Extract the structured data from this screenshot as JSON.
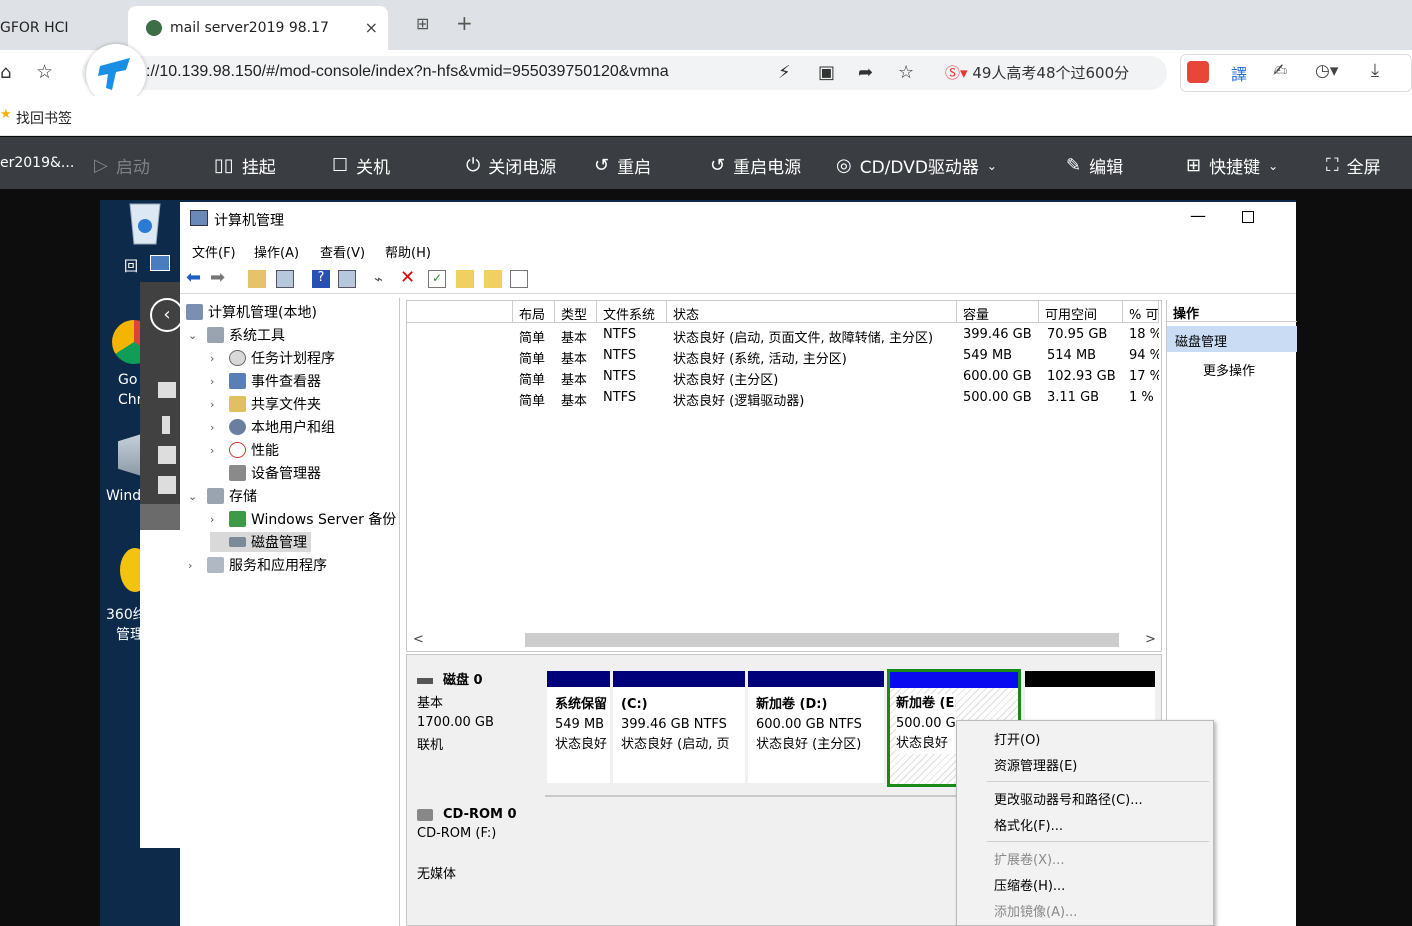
{
  "browser": {
    "tabs": [
      {
        "label": "GFOR HCI"
      },
      {
        "label": "mail server2019 98.17",
        "close": "×"
      }
    ],
    "new_tab": "+",
    "url": "://10.139.98.150/#/mod-console/index?n-hfs&vmid=955039750120&vmna",
    "hot_search": "49人高考48个过600分",
    "bookmark": "找回书签"
  },
  "console_toolbar": {
    "vm_name": "er2019&...",
    "buttons": [
      {
        "label": "启动",
        "icon": "play-icon",
        "disabled": true
      },
      {
        "label": "挂起",
        "icon": "pause-icon",
        "disabled": false
      },
      {
        "label": "关机",
        "icon": "stop-icon",
        "disabled": false
      },
      {
        "label": "关闭电源",
        "icon": "power-icon",
        "disabled": false
      },
      {
        "label": "重启",
        "icon": "restart-icon",
        "disabled": false
      },
      {
        "label": "重启电源",
        "icon": "power-restart-icon",
        "disabled": false
      },
      {
        "label": "CD/DVD驱动器",
        "icon": "disc-icon",
        "disabled": false
      },
      {
        "label": "编辑",
        "icon": "edit-icon",
        "disabled": false
      },
      {
        "label": "快捷键",
        "icon": "shortcut-icon",
        "disabled": false
      },
      {
        "label": "全屏",
        "icon": "fullscreen-icon",
        "disabled": false
      }
    ]
  },
  "desktop": {
    "icons": [
      {
        "label": "回"
      },
      {
        "label": "Go"
      },
      {
        "label": "Chr"
      },
      {
        "label": "Wind"
      },
      {
        "label": "360终"
      },
      {
        "label": "管理"
      }
    ]
  },
  "window": {
    "title": "计算机管理",
    "menus": [
      "文件(F)",
      "操作(A)",
      "查看(V)",
      "帮助(H)"
    ],
    "tree": [
      {
        "label": "计算机管理(本地)"
      },
      {
        "label": "系统工具"
      },
      {
        "label": "任务计划程序"
      },
      {
        "label": "事件查看器"
      },
      {
        "label": "共享文件夹"
      },
      {
        "label": "本地用户和组"
      },
      {
        "label": "性能"
      },
      {
        "label": "设备管理器"
      },
      {
        "label": "存储"
      },
      {
        "label": "Windows Server 备份"
      },
      {
        "label": "磁盘管理"
      },
      {
        "label": "服务和应用程序"
      }
    ],
    "columns": [
      "布局",
      "类型",
      "文件系统",
      "状态",
      "容量",
      "可用空间",
      "% 可"
    ],
    "rows": [
      [
        "简单",
        "基本",
        "NTFS",
        "状态良好 (启动, 页面文件, 故障转储, 主分区)",
        "399.46 GB",
        "70.95 GB",
        "18 %"
      ],
      [
        "简单",
        "基本",
        "NTFS",
        "状态良好 (系统, 活动, 主分区)",
        "549 MB",
        "514 MB",
        "94 %"
      ],
      [
        "简单",
        "基本",
        "NTFS",
        "状态良好 (主分区)",
        "600.00 GB",
        "102.93 GB",
        "17 %"
      ],
      [
        "简单",
        "基本",
        "NTFS",
        "状态良好 (逻辑驱动器)",
        "500.00 GB",
        "3.11 GB",
        "1 %"
      ]
    ],
    "scroll_left": "<",
    "scroll_right": ">",
    "disk0": {
      "name": "磁盘 0",
      "type": "基本",
      "size": "1700.00 GB",
      "state": "联机",
      "partitions": [
        {
          "name": "系统保留",
          "size": "549 MB",
          "status": "状态良好"
        },
        {
          "name": "(C:)",
          "size": "399.46 GB NTFS",
          "status": "状态良好 (启动, 页"
        },
        {
          "name": "新加卷 (D:)",
          "size": "600.00 GB NTFS",
          "status": "状态良好 (主分区)"
        },
        {
          "name": "新加卷 (E:)",
          "size": "500.00 GB",
          "status": "状态良好"
        }
      ]
    },
    "cdrom": {
      "name": "CD-ROM 0",
      "type": "CD-ROM (F:)",
      "state": "无媒体"
    },
    "actions": {
      "header": "操作",
      "selected": "磁盘管理",
      "more": "更多操作"
    }
  },
  "context_menu": [
    {
      "label": "打开(O)",
      "disabled": false
    },
    {
      "label": "资源管理器(E)",
      "disabled": false
    },
    {
      "label": "更改驱动器号和路径(C)...",
      "disabled": false
    },
    {
      "label": "格式化(F)...",
      "disabled": false
    },
    {
      "label": "扩展卷(X)...",
      "disabled": true
    },
    {
      "label": "压缩卷(H)...",
      "disabled": false
    },
    {
      "label": "添加镜像(A)...",
      "disabled": true
    }
  ]
}
